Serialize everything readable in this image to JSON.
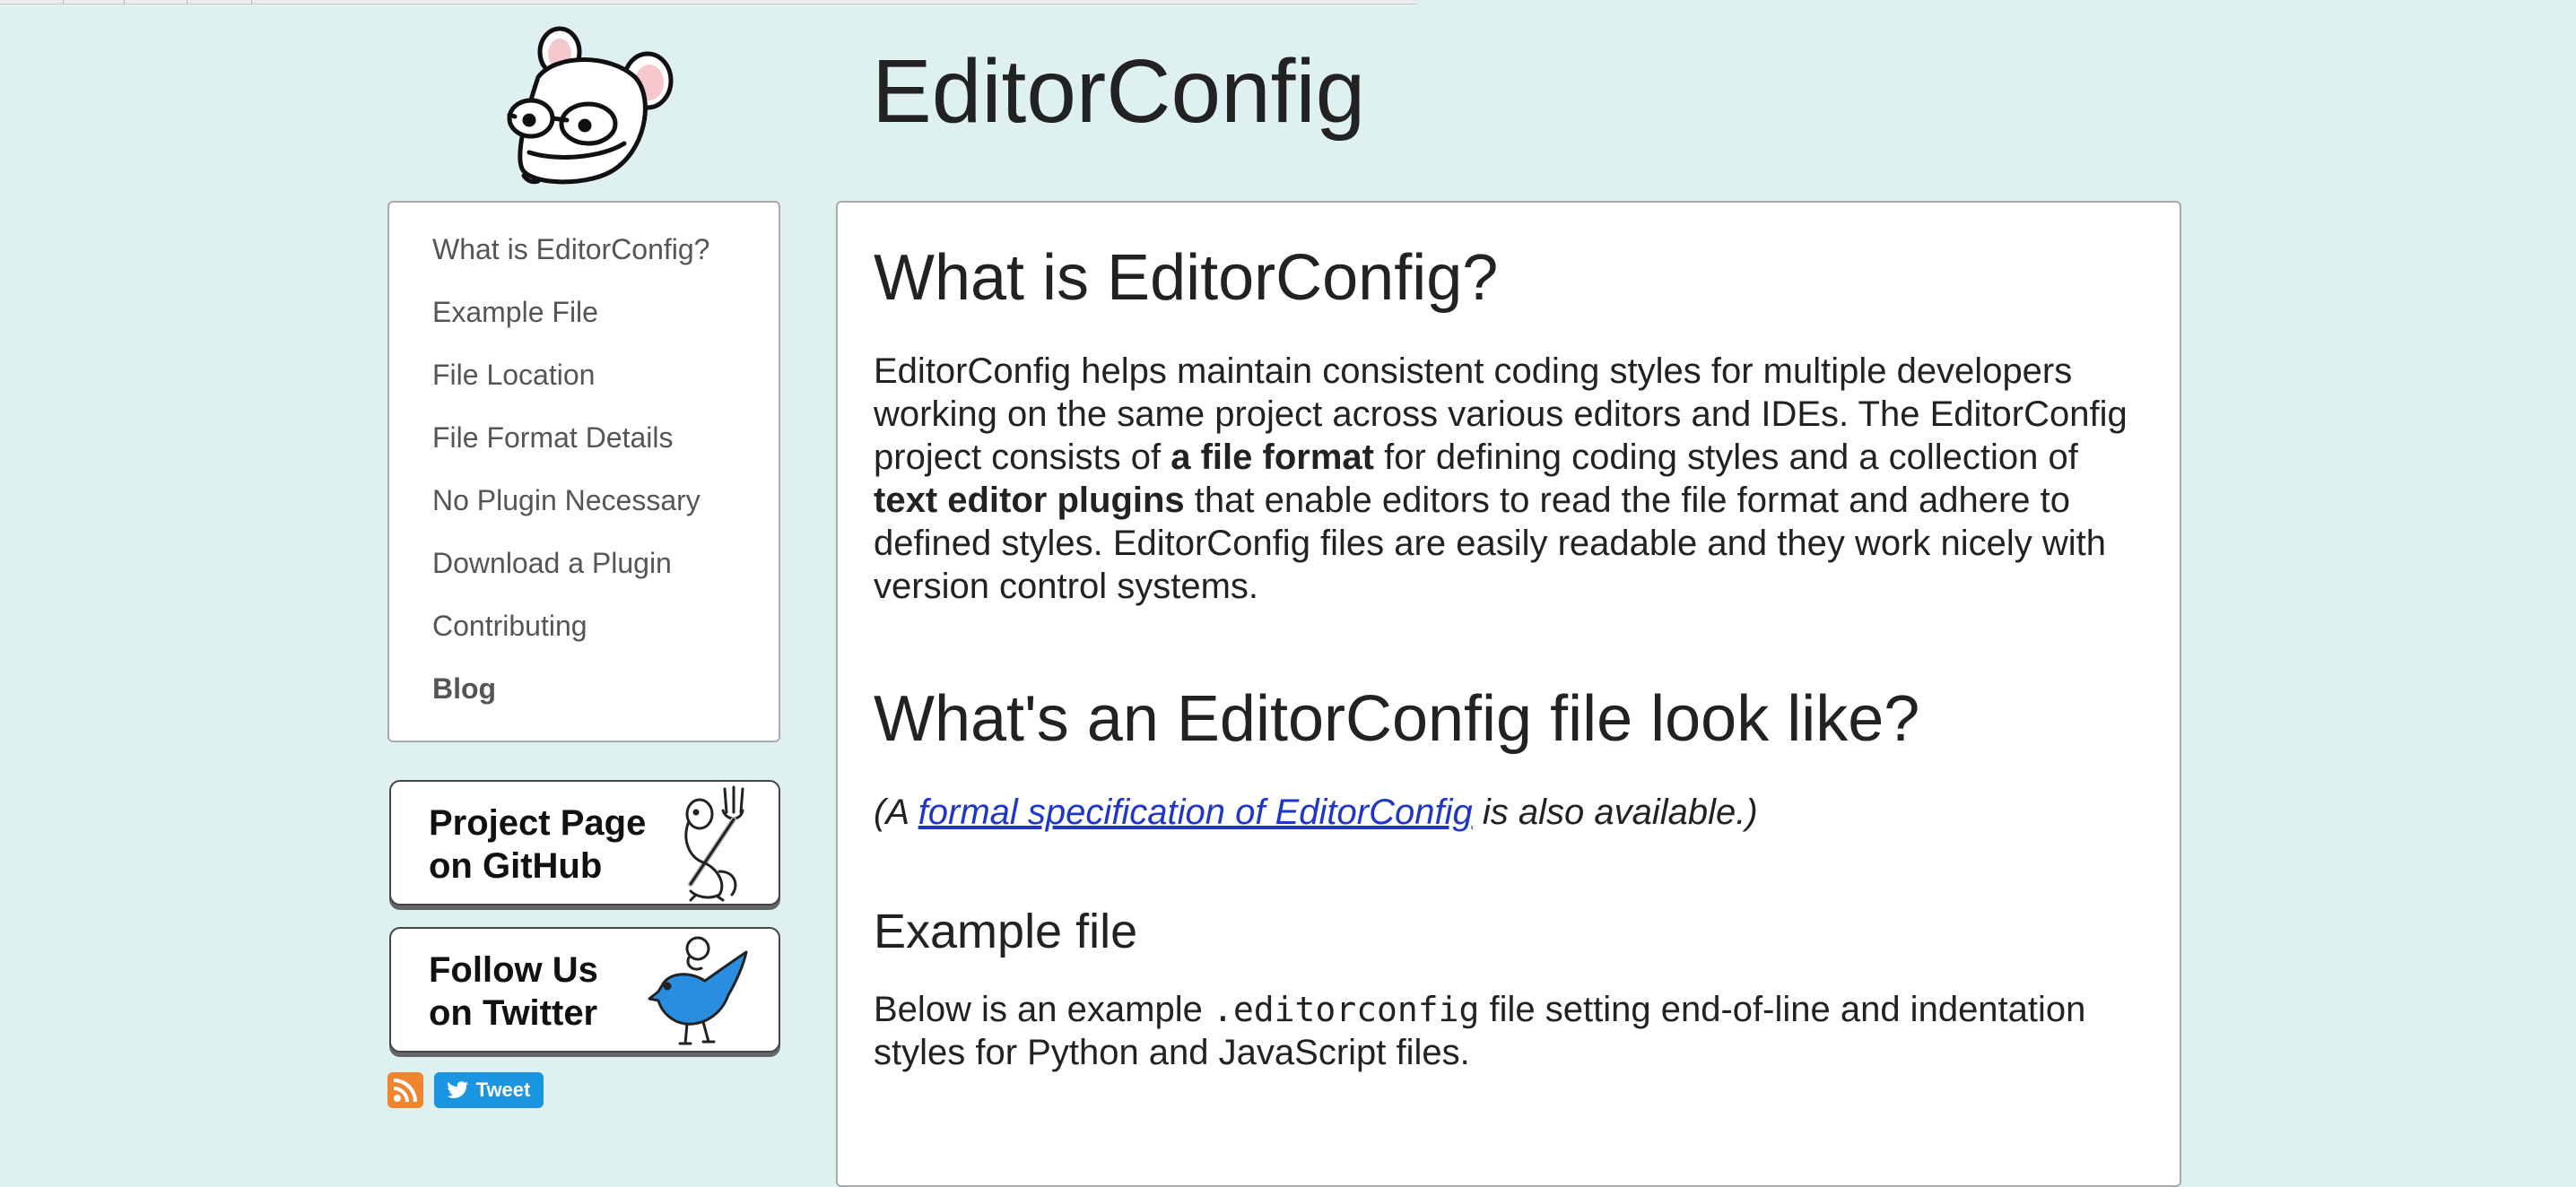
{
  "site": {
    "title": "EditorConfig"
  },
  "sidebar": {
    "items": [
      {
        "label": "What is EditorConfig?"
      },
      {
        "label": "Example File"
      },
      {
        "label": "File Location"
      },
      {
        "label": "File Format Details"
      },
      {
        "label": "No Plugin Necessary"
      },
      {
        "label": "Download a Plugin"
      },
      {
        "label": "Contributing"
      },
      {
        "label": "Blog"
      }
    ]
  },
  "badges": {
    "github": {
      "line1": "Project Page",
      "line2": "on GitHub"
    },
    "twitter": {
      "line1": "Follow Us",
      "line2": "on Twitter"
    }
  },
  "social": {
    "tweet_label": "Tweet"
  },
  "content": {
    "heading_what": "What is EditorConfig?",
    "what_para": {
      "t1": "EditorConfig helps maintain consistent coding styles for multiple developers working on the same project across various editors and IDEs. The EditorConfig project consists of ",
      "b1": "a file format",
      "t2": " for defining coding styles and a collection of ",
      "b2": "text editor plugins",
      "t3": " that enable editors to read the file format and adhere to defined styles. EditorConfig files are easily readable and they work nicely with version control systems."
    },
    "heading_look": "What's an EditorConfig file look like?",
    "spec_note": {
      "prefix": "(A ",
      "link": "formal specification of EditorConfig",
      "suffix": " is also available.)"
    },
    "heading_example": "Example file",
    "example_para": {
      "t1": "Below is an example ",
      "code": ".editorconfig",
      "t2": " file setting end-of-line and indentation styles for Python and JavaScript files."
    }
  },
  "colors": {
    "background": "#def0f0",
    "link": "#1f36c6",
    "rss": "#f0852f",
    "tweet": "#1b95e0",
    "bird": "#2a8ee0"
  },
  "icons": [
    "mouse-logo-icon",
    "mouse-fork-icon",
    "bird-mouse-icon",
    "rss-icon",
    "twitter-bird-icon"
  ]
}
